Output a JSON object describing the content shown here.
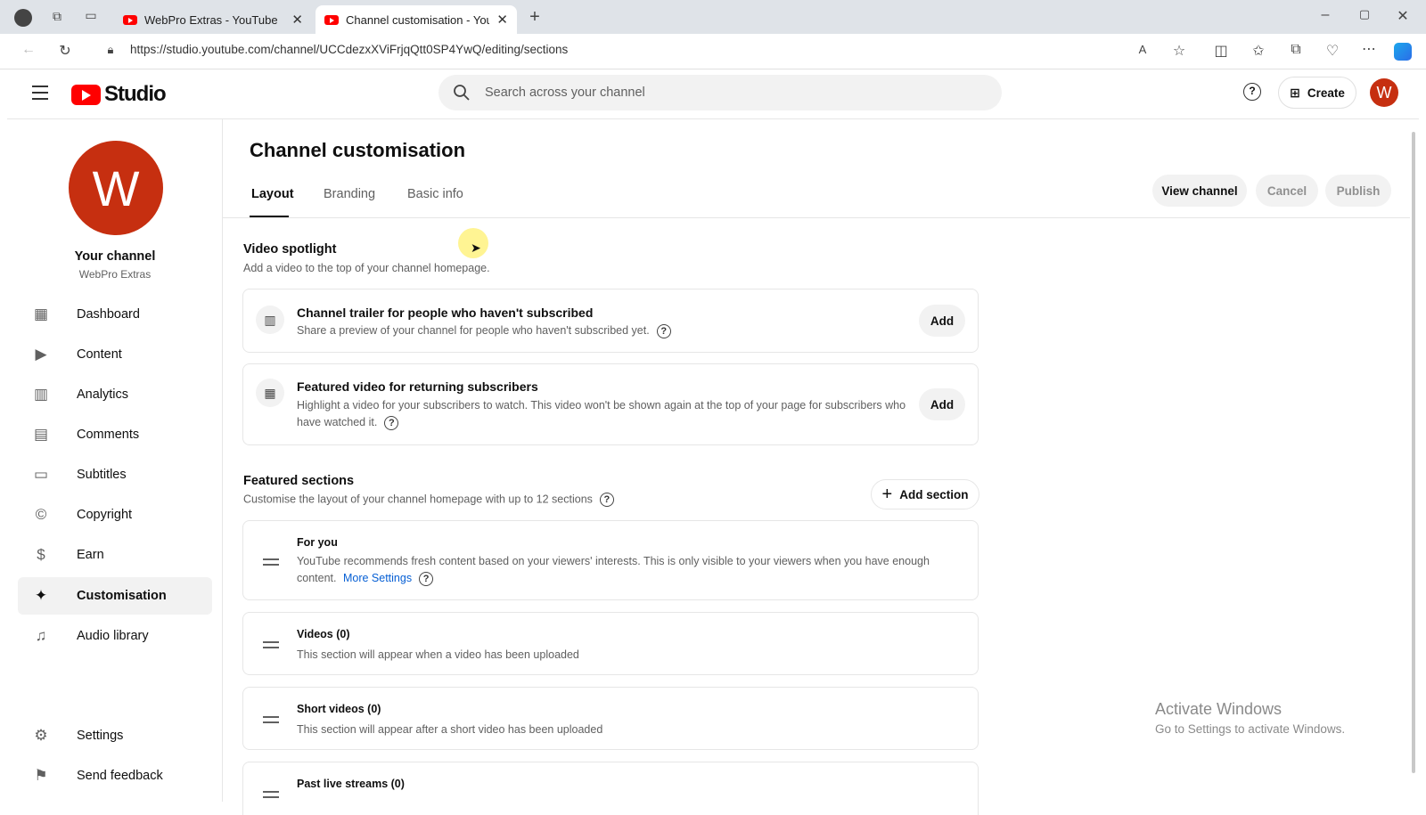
{
  "browser": {
    "tabs": [
      {
        "title": "WebPro Extras - YouTube"
      },
      {
        "title": "Channel customisation - YouTube"
      }
    ],
    "url": "https://studio.youtube.com/channel/UCCdezxXViFrjqQtt0SP4YwQ/editing/sections"
  },
  "header": {
    "logo_text": "Studio",
    "search_placeholder": "Search across your channel",
    "create_label": "Create",
    "avatar_letter": "W"
  },
  "sidebar": {
    "avatar_letter": "W",
    "channel_label": "Your channel",
    "channel_name": "WebPro Extras",
    "items": [
      {
        "label": "Dashboard"
      },
      {
        "label": "Content"
      },
      {
        "label": "Analytics"
      },
      {
        "label": "Comments"
      },
      {
        "label": "Subtitles"
      },
      {
        "label": "Copyright"
      },
      {
        "label": "Earn"
      },
      {
        "label": "Customisation"
      },
      {
        "label": "Audio library"
      }
    ],
    "settings_label": "Settings",
    "feedback_label": "Send feedback"
  },
  "main": {
    "page_title": "Channel customisation",
    "tabs": [
      {
        "label": "Layout"
      },
      {
        "label": "Branding"
      },
      {
        "label": "Basic info"
      }
    ],
    "view_channel_label": "View channel",
    "cancel_label": "Cancel",
    "publish_label": "Publish",
    "spotlight": {
      "title": "Video spotlight",
      "desc": "Add a video to the top of your channel homepage.",
      "trailer": {
        "title": "Channel trailer for people who haven't subscribed",
        "desc": "Share a preview of your channel for people who haven't subscribed yet.",
        "add_label": "Add"
      },
      "featured": {
        "title": "Featured video for returning subscribers",
        "desc1": "Highlight a video for your subscribers to watch. This video won't be shown again at the top of your page for subscribers who",
        "desc2": "have watched it.",
        "add_label": "Add"
      }
    },
    "sections": {
      "title": "Featured sections",
      "desc": "Customise the layout of your channel homepage with up to 12 sections",
      "add_section_label": "Add section",
      "for_you": {
        "title": "For you",
        "desc1": "YouTube recommends fresh content based on your viewers' interests. This is only visible to your viewers when you have enough",
        "desc2": "content.",
        "link": "More Settings"
      },
      "videos": {
        "title": "Videos (0)",
        "desc": "This section will appear when a video has been uploaded"
      },
      "shorts": {
        "title": "Short videos (0)",
        "desc": "This section will appear after a short video has been uploaded"
      },
      "live": {
        "title": "Past live streams (0)"
      }
    }
  },
  "watermark": {
    "line1": "Activate Windows",
    "line2": "Go to Settings to activate Windows."
  }
}
